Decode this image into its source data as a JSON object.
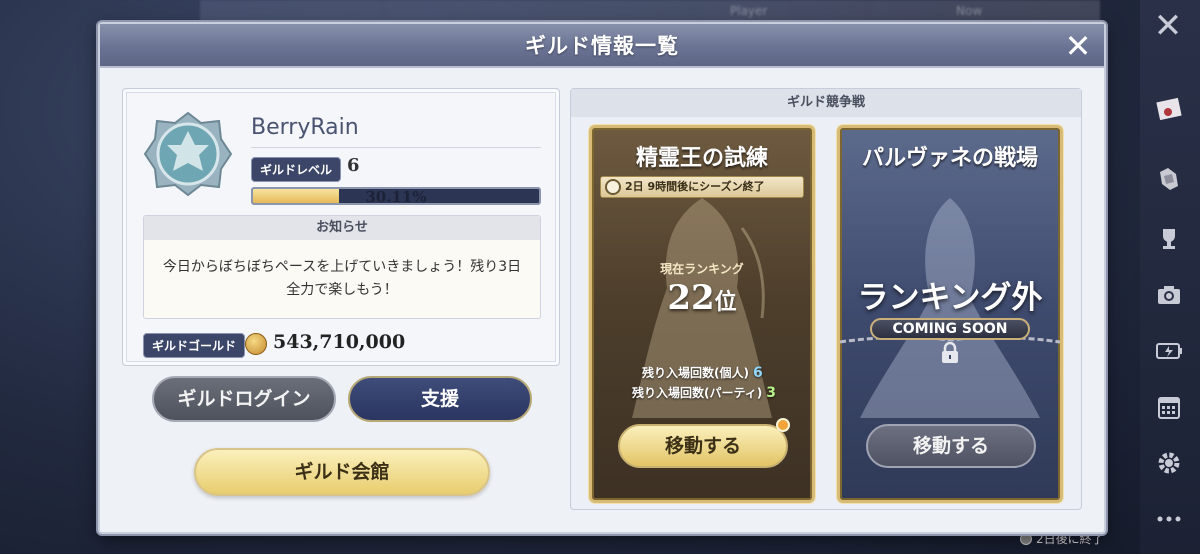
{
  "background": {
    "top_labels": [
      "Player",
      "Now"
    ],
    "bottom_timer": "2日後に終了"
  },
  "panel": {
    "title": "ギルド情報一覧",
    "close_icon": "close-icon"
  },
  "guild": {
    "name": "BerryRain",
    "level_label": "ギルドレベル",
    "level": "6",
    "progress_text": "30.11%",
    "progress_fraction": 0.3011,
    "notice_title": "お知らせ",
    "notice_text": "今日からぼちぼちペースを上げていきましょう！残り3日全力で楽しもう！",
    "gold_label": "ギルドゴールド",
    "gold_value": "543,710,000"
  },
  "buttons": {
    "login": "ギルドログイン",
    "support": "支援",
    "hall": "ギルド会館"
  },
  "war": {
    "title": "ギルド競争戦",
    "cards": [
      {
        "title": "精霊王の試練",
        "season": "2日 9時間後にシーズン終了",
        "rank_label": "現在ランキング",
        "rank_value": "22",
        "rank_suffix": "位",
        "entry_personal_label": "残り入場回数(個人)",
        "entry_personal_value": "6",
        "entry_party_label": "残り入場回数(パーティ)",
        "entry_party_value": "3",
        "button": "移動する"
      },
      {
        "title": "パルヴァネの戦場",
        "status": "ランキング外",
        "coming_soon": "COMING SOON",
        "button": "移動する"
      }
    ]
  },
  "rail_icons": [
    "mail-icon",
    "gauntlet-icon",
    "trophy-icon",
    "camera-icon",
    "battery-icon",
    "calendar-icon",
    "gear-icon",
    "more-icon"
  ],
  "colors": {
    "header": "#6a7393",
    "gold": "#e8cd6e",
    "navy": "#2a3560"
  }
}
